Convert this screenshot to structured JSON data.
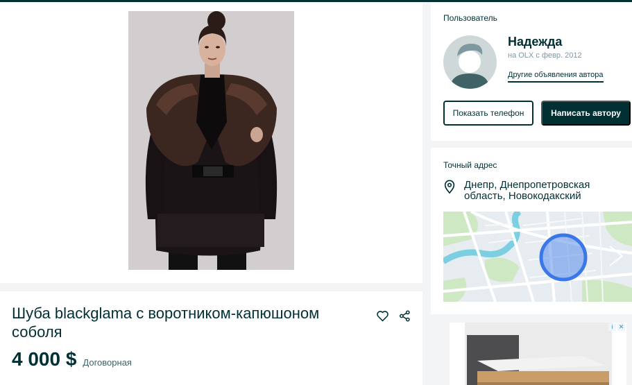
{
  "listing": {
    "title": "Шуба blackglama с воротником-капюшоном соболя",
    "price": "4 000 $",
    "negotiable": "Договорная"
  },
  "user": {
    "section_label": "Пользователь",
    "name": "Надежда",
    "since": "на OLX с февр. 2012",
    "other_ads_link": "Другие объявления автора",
    "show_phone_button": "Показать телефон",
    "message_button": "Написать автору"
  },
  "address": {
    "section_label": "Точный адрес",
    "location": "Днепр, Днепропетровская область, Новокодакский"
  },
  "ad": {
    "info_badge": "i",
    "close_badge": "✕"
  },
  "colors": {
    "primary": "#002f34",
    "page_background": "#f2f4f5",
    "map_marker": "#3a77e8"
  },
  "icons": {
    "favorite": "heart-icon",
    "share": "share-icon",
    "location": "location-pin-icon"
  }
}
